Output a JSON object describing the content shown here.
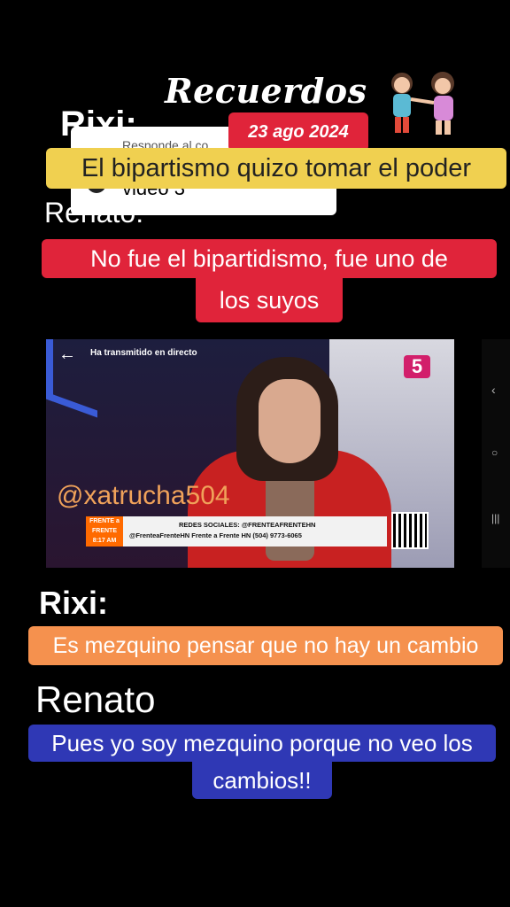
{
  "header": {
    "title": "Recuerdos",
    "date": "23 ago 2024"
  },
  "ghost_overlay": {
    "reply_text": "Responde al co...",
    "video_label": "video 3"
  },
  "speakers": {
    "rixi_1": "Rixi:",
    "renato_1": "Renato:",
    "rixi_2": "Rixi:",
    "renato_2": "Renato"
  },
  "captions": {
    "yellow": "El bipartismo quizo tomar el poder",
    "red_line1": "No fue el bipartidismo, fue uno de",
    "red_line2": "los suyos",
    "orange": "Es mezquino pensar que no hay un cambio",
    "blue_line1": "Pues yo soy mezquino porque no veo los",
    "blue_line2": "cambios!!"
  },
  "video": {
    "status": "Ha transmitido en directo",
    "watermark": "@xatrucha504",
    "channel_logo": "5",
    "program_tag": "FRENTE a FRENTE 8:17 AM",
    "social_title": "REDES SOCIALES: @FRENTEAFRENTEHN",
    "social_line": "@FrenteaFrenteHN  Frente a Frente HN  (504) 9773-6065"
  },
  "controls": {
    "back_icon": "arrow-left",
    "nav_icons": [
      "chevron-left",
      "home-circle",
      "recents"
    ]
  }
}
